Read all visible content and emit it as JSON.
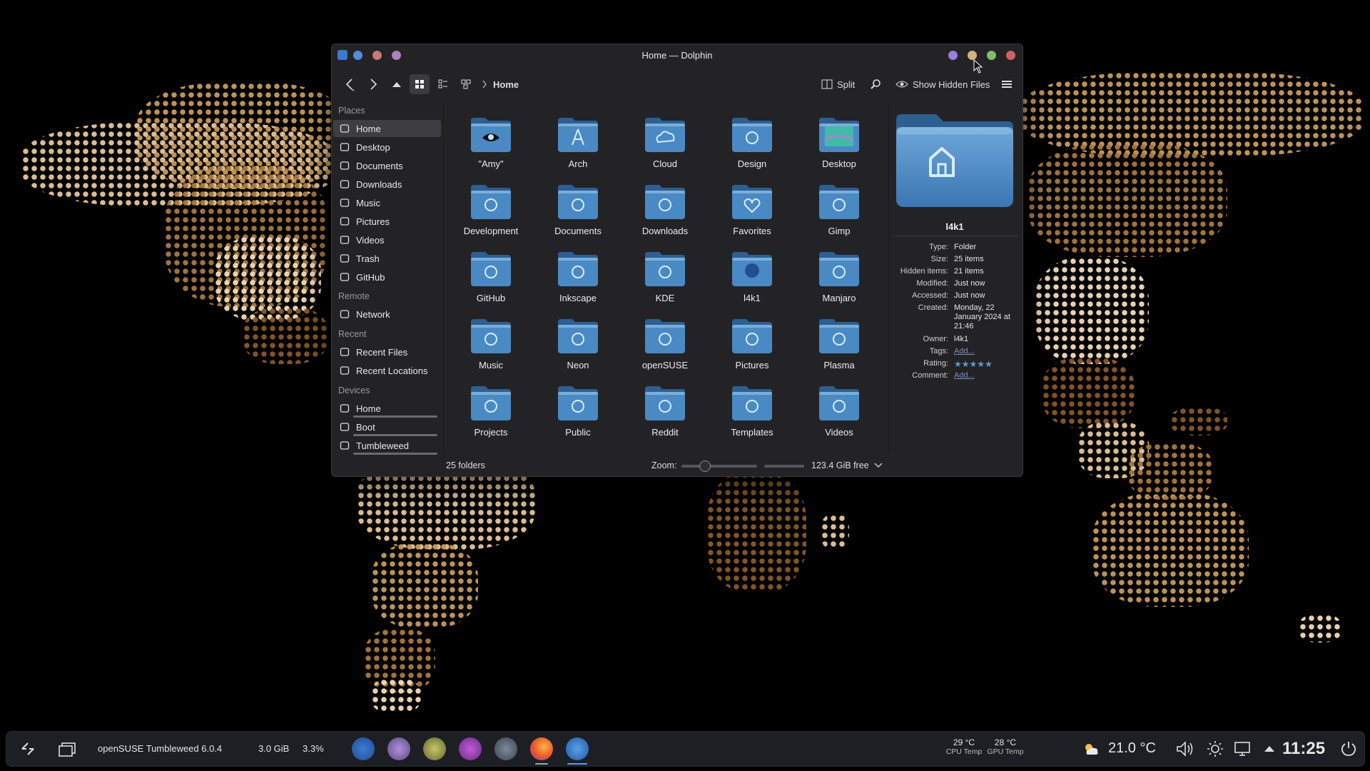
{
  "window": {
    "title": "Home — Dolphin",
    "app_icon": "dolphin-icon"
  },
  "toolbar": {
    "breadcrumb": "Home",
    "split_label": "Split",
    "hidden_files_label": "Show Hidden Files"
  },
  "sidebar": {
    "places_heading": "Places",
    "places": [
      {
        "label": "Home",
        "icon": "home-icon"
      },
      {
        "label": "Desktop",
        "icon": "desktop-icon"
      },
      {
        "label": "Documents",
        "icon": "documents-icon"
      },
      {
        "label": "Downloads",
        "icon": "downloads-icon"
      },
      {
        "label": "Music",
        "icon": "music-icon"
      },
      {
        "label": "Pictures",
        "icon": "pictures-icon"
      },
      {
        "label": "Videos",
        "icon": "videos-icon"
      },
      {
        "label": "Trash",
        "icon": "trash-icon"
      },
      {
        "label": "GitHub",
        "icon": "github-icon"
      }
    ],
    "remote_heading": "Remote",
    "remote": [
      {
        "label": "Network",
        "icon": "network-icon"
      }
    ],
    "recent_heading": "Recent",
    "recent": [
      {
        "label": "Recent Files",
        "icon": "recent-files-icon"
      },
      {
        "label": "Recent Locations",
        "icon": "recent-locations-icon"
      }
    ],
    "devices_heading": "Devices",
    "devices": [
      {
        "label": "Home",
        "icon": "drive-icon"
      },
      {
        "label": "Boot",
        "icon": "drive-icon"
      },
      {
        "label": "Tumbleweed",
        "icon": "drive-icon"
      }
    ]
  },
  "folders": [
    {
      "name": "\"Amy\"",
      "emblem": "eye"
    },
    {
      "name": "Arch",
      "emblem": "arch"
    },
    {
      "name": "Cloud",
      "emblem": "cloud"
    },
    {
      "name": "Design",
      "emblem": "design"
    },
    {
      "name": "Desktop",
      "emblem": "desktop"
    },
    {
      "name": "Development",
      "emblem": "window"
    },
    {
      "name": "Documents",
      "emblem": "doc"
    },
    {
      "name": "Downloads",
      "emblem": "download"
    },
    {
      "name": "Favorites",
      "emblem": "heart"
    },
    {
      "name": "Gimp",
      "emblem": "gimp"
    },
    {
      "name": "GitHub",
      "emblem": "github"
    },
    {
      "name": "Inkscape",
      "emblem": "inkscape"
    },
    {
      "name": "KDE",
      "emblem": "kde"
    },
    {
      "name": "l4k1",
      "emblem": "avatar"
    },
    {
      "name": "Manjaro",
      "emblem": "manjaro"
    },
    {
      "name": "Music",
      "emblem": "music"
    },
    {
      "name": "Neon",
      "emblem": "neon"
    },
    {
      "name": "openSUSE",
      "emblem": "suse"
    },
    {
      "name": "Pictures",
      "emblem": "picture"
    },
    {
      "name": "Plasma",
      "emblem": "plasma"
    },
    {
      "name": "Projects",
      "emblem": "gear"
    },
    {
      "name": "Public",
      "emblem": "people"
    },
    {
      "name": "Reddit",
      "emblem": "reddit"
    },
    {
      "name": "Templates",
      "emblem": "template"
    },
    {
      "name": "Videos",
      "emblem": "video"
    }
  ],
  "status": {
    "count": "25 folders",
    "zoom_label": "Zoom:",
    "zoom_level": 0.3,
    "free_space": "123.4 GiB free"
  },
  "info_panel": {
    "name": "l4k1",
    "rows": [
      {
        "key": "Type:",
        "value": "Folder"
      },
      {
        "key": "Size:",
        "value": "25 items"
      },
      {
        "key": "Hidden items:",
        "value": "21 items"
      },
      {
        "key": "Modified:",
        "value": "Just now"
      },
      {
        "key": "Accessed:",
        "value": "Just now"
      },
      {
        "key": "Created:",
        "value": "Monday, 22 January 2024 at 21:46"
      },
      {
        "key": "Owner:",
        "value": "l4k1"
      },
      {
        "key": "Tags:",
        "value": "Add..."
      },
      {
        "key": "Rating:",
        "value": ""
      },
      {
        "key": "Comment:",
        "value": "Add..."
      }
    ],
    "rating": 5
  },
  "taskbar": {
    "distro": "openSUSE Tumbleweed 6.0.4",
    "memory": "3.0 GiB",
    "cpu": "3.3%",
    "cpu_temp_value": "29 °C",
    "cpu_temp_label": "CPU Temp",
    "gpu_temp_value": "28 °C",
    "gpu_temp_label": "GPU Temp",
    "weather": "21.0 °C",
    "clock": "11:25",
    "apps": [
      "system-monitor-icon",
      "app-icon-2",
      "app-icon-3",
      "app-icon-4",
      "app-icon-5",
      "firefox-icon",
      "dolphin-icon"
    ]
  },
  "colors": {
    "accent": "#5b9bd5",
    "folder_blue": "#4a8ac4",
    "map_gold": "#c99a5a"
  }
}
